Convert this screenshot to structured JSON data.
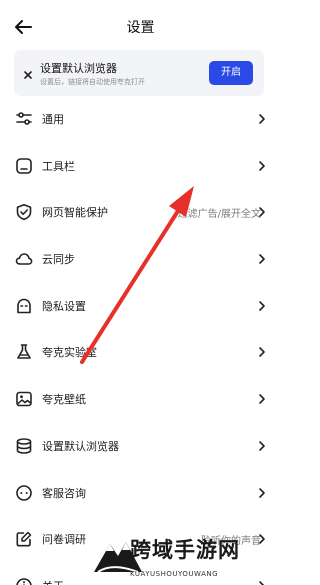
{
  "header": {
    "title": "设置"
  },
  "banner": {
    "title": "设置默认浏览器",
    "subtitle": "设置后，链接将自动使用夸克打开",
    "button_label": "开启"
  },
  "items": [
    {
      "label": "通用",
      "value": "",
      "icon": "sliders-icon"
    },
    {
      "label": "工具栏",
      "value": "",
      "icon": "toolbar-icon"
    },
    {
      "label": "网页智能保护",
      "value": "过滤广告/展开全文",
      "icon": "shield-check-icon"
    },
    {
      "label": "云同步",
      "value": "",
      "icon": "cloud-icon"
    },
    {
      "label": "隐私设置",
      "value": "",
      "icon": "privacy-mask-icon"
    },
    {
      "label": "夸克实验室",
      "value": "",
      "icon": "flask-icon"
    },
    {
      "label": "夸克壁纸",
      "value": "",
      "icon": "wallpaper-icon"
    },
    {
      "label": "设置默认浏览器",
      "value": "",
      "icon": "database-icon"
    },
    {
      "label": "客服咨询",
      "value": "",
      "icon": "chat-icon"
    },
    {
      "label": "问卷调研",
      "value": "聆听你的声音",
      "icon": "survey-icon"
    },
    {
      "label": "关于",
      "value": "",
      "icon": "info-icon"
    }
  ],
  "watermark": {
    "title": "跨域手游网",
    "subtitle": "KUAYUSHOUYOUWANG"
  },
  "colors": {
    "accent": "#2b49e6",
    "arrow": "#e8302a"
  }
}
